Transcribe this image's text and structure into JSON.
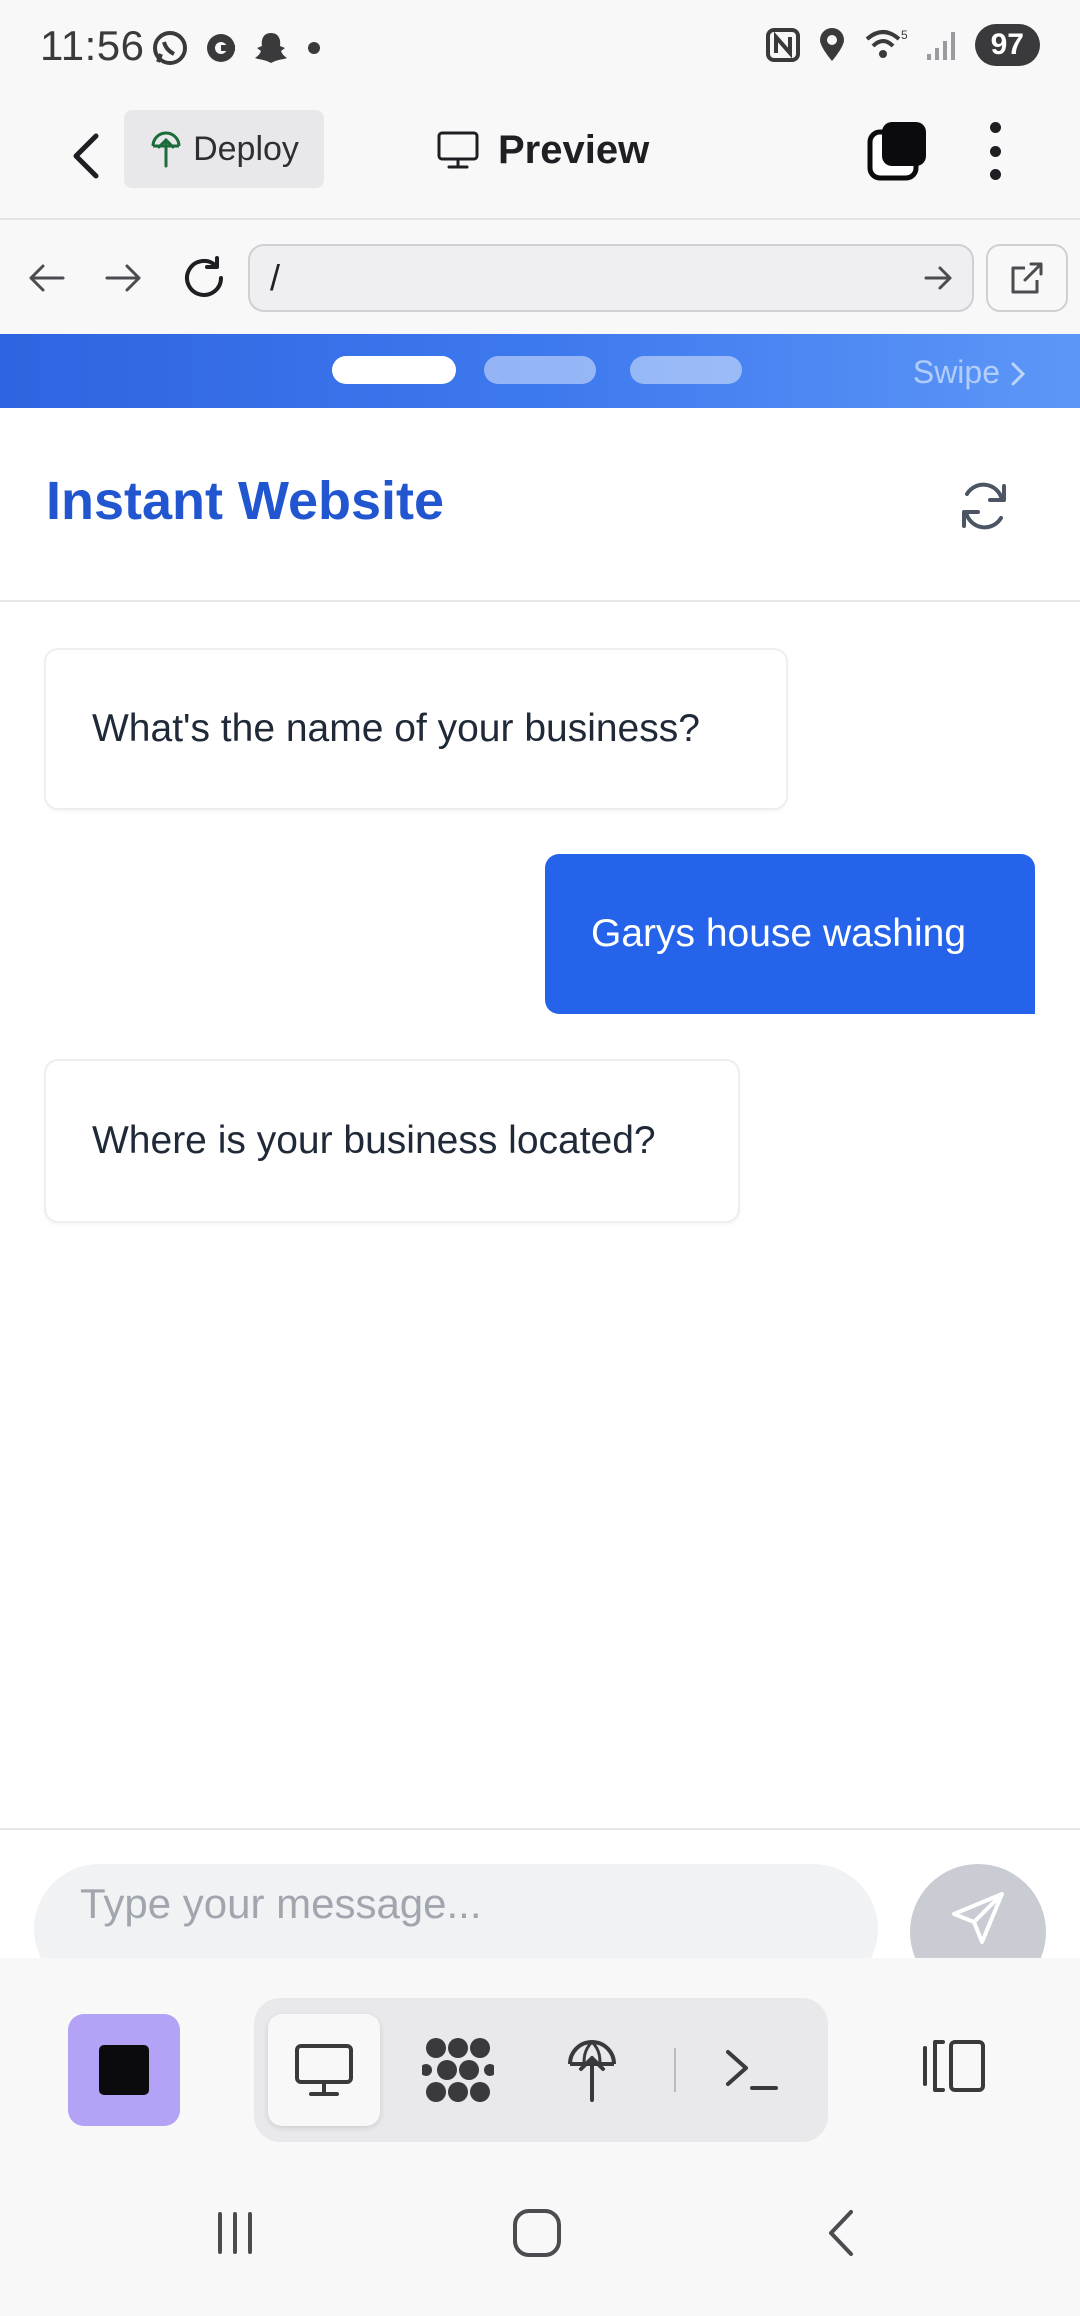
{
  "status_bar": {
    "time": "11:56",
    "battery": "97",
    "notification_icons": [
      "whatsapp-icon",
      "c-app-icon",
      "snapchat-icon",
      "dot-icon"
    ],
    "system_icons": [
      "nfc-icon",
      "location-icon",
      "wifi-icon",
      "signal-icon"
    ]
  },
  "app_bar": {
    "deploy_label": "Deploy",
    "preview_label": "Preview"
  },
  "browser": {
    "url_value": "/"
  },
  "swipe": {
    "label": "Swipe",
    "page_count": 3,
    "active_page": 1
  },
  "site": {
    "title": "Instant Website",
    "accent_color": "#2156d0"
  },
  "chat": {
    "messages": [
      {
        "role": "bot",
        "text": "What's the name of your business?"
      },
      {
        "role": "user",
        "text": "Garys house washing"
      },
      {
        "role": "bot",
        "text": "Where is your business located?"
      }
    ],
    "input_placeholder": "Type your message...",
    "user_bubble_color": "#2563eb"
  },
  "toolbar": {
    "stop_color": "#b3a2f6",
    "modes": [
      "monitor-icon",
      "nodes-icon",
      "deploy-icon",
      "terminal-icon"
    ],
    "active_mode": "monitor-icon"
  }
}
